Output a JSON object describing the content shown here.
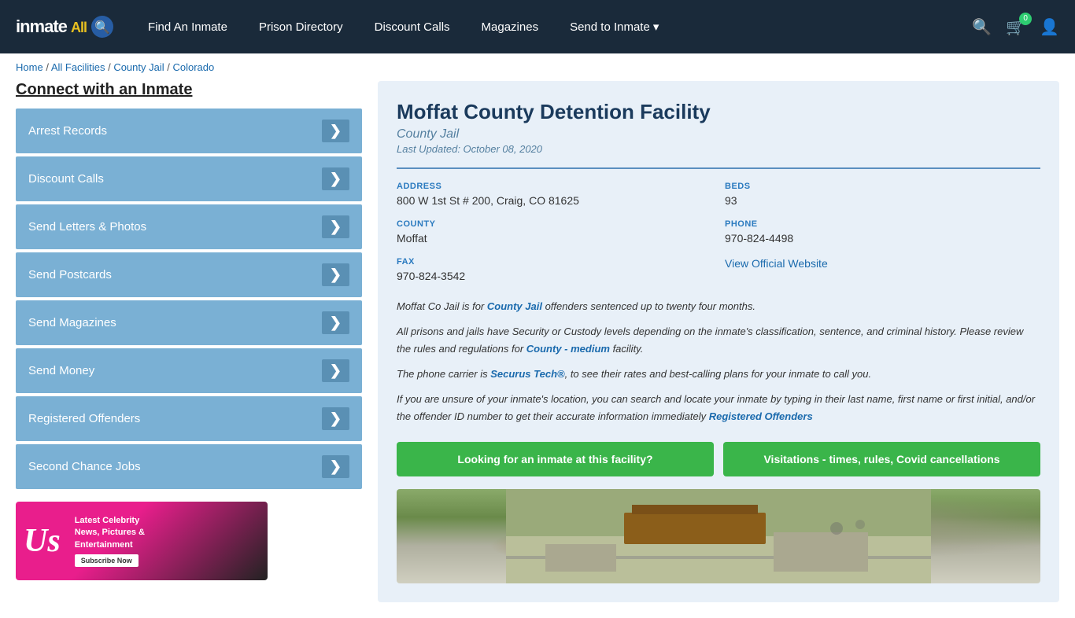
{
  "nav": {
    "logo_text": "inmate",
    "logo_suffix": "All",
    "links": [
      {
        "label": "Find An Inmate",
        "id": "find-inmate"
      },
      {
        "label": "Prison Directory",
        "id": "prison-directory"
      },
      {
        "label": "Discount Calls",
        "id": "discount-calls"
      },
      {
        "label": "Magazines",
        "id": "magazines"
      },
      {
        "label": "Send to Inmate",
        "id": "send-to-inmate"
      }
    ],
    "cart_count": "0",
    "send_dropdown_arrow": "▾"
  },
  "breadcrumb": {
    "home": "Home",
    "all_facilities": "All Facilities",
    "county_jail": "County Jail",
    "state": "Colorado",
    "separator": "/"
  },
  "sidebar": {
    "connect_title": "Connect with an Inmate",
    "menu_items": [
      {
        "label": "Arrest Records"
      },
      {
        "label": "Discount Calls"
      },
      {
        "label": "Send Letters & Photos"
      },
      {
        "label": "Send Postcards"
      },
      {
        "label": "Send Magazines"
      },
      {
        "label": "Send Money"
      },
      {
        "label": "Registered Offenders"
      },
      {
        "label": "Second Chance Jobs"
      }
    ],
    "arrow": "❯",
    "ad": {
      "logo": "Us",
      "headline": "Latest Celebrity",
      "line2": "News, Pictures &",
      "line3": "Entertainment",
      "subscribe": "Subscribe Now"
    }
  },
  "facility": {
    "title": "Moffat County Detention Facility",
    "type": "County Jail",
    "last_updated": "Last Updated: October 08, 2020",
    "address_label": "ADDRESS",
    "address_value": "800 W 1st St # 200, Craig, CO 81625",
    "beds_label": "BEDS",
    "beds_value": "93",
    "county_label": "COUNTY",
    "county_value": "Moffat",
    "phone_label": "PHONE",
    "phone_value": "970-824-4498",
    "fax_label": "FAX",
    "fax_value": "970-824-3542",
    "website_label": "View Official Website",
    "description1": "Moffat Co Jail is for County Jail offenders sentenced up to twenty four months.",
    "description2": "All prisons and jails have Security or Custody levels depending on the inmate's classification, sentence, and criminal history. Please review the rules and regulations for County - medium facility.",
    "description3": "The phone carrier is Securus Tech®, to see their rates and best-calling plans for your inmate to call you.",
    "description4": "If you are unsure of your inmate's location, you can search and locate your inmate by typing in their last name, first name or first initial, and/or the offender ID number to get their accurate information immediately Registered Offenders",
    "btn1": "Looking for an inmate at this facility?",
    "btn2": "Visitations - times, rules, Covid cancellations"
  }
}
